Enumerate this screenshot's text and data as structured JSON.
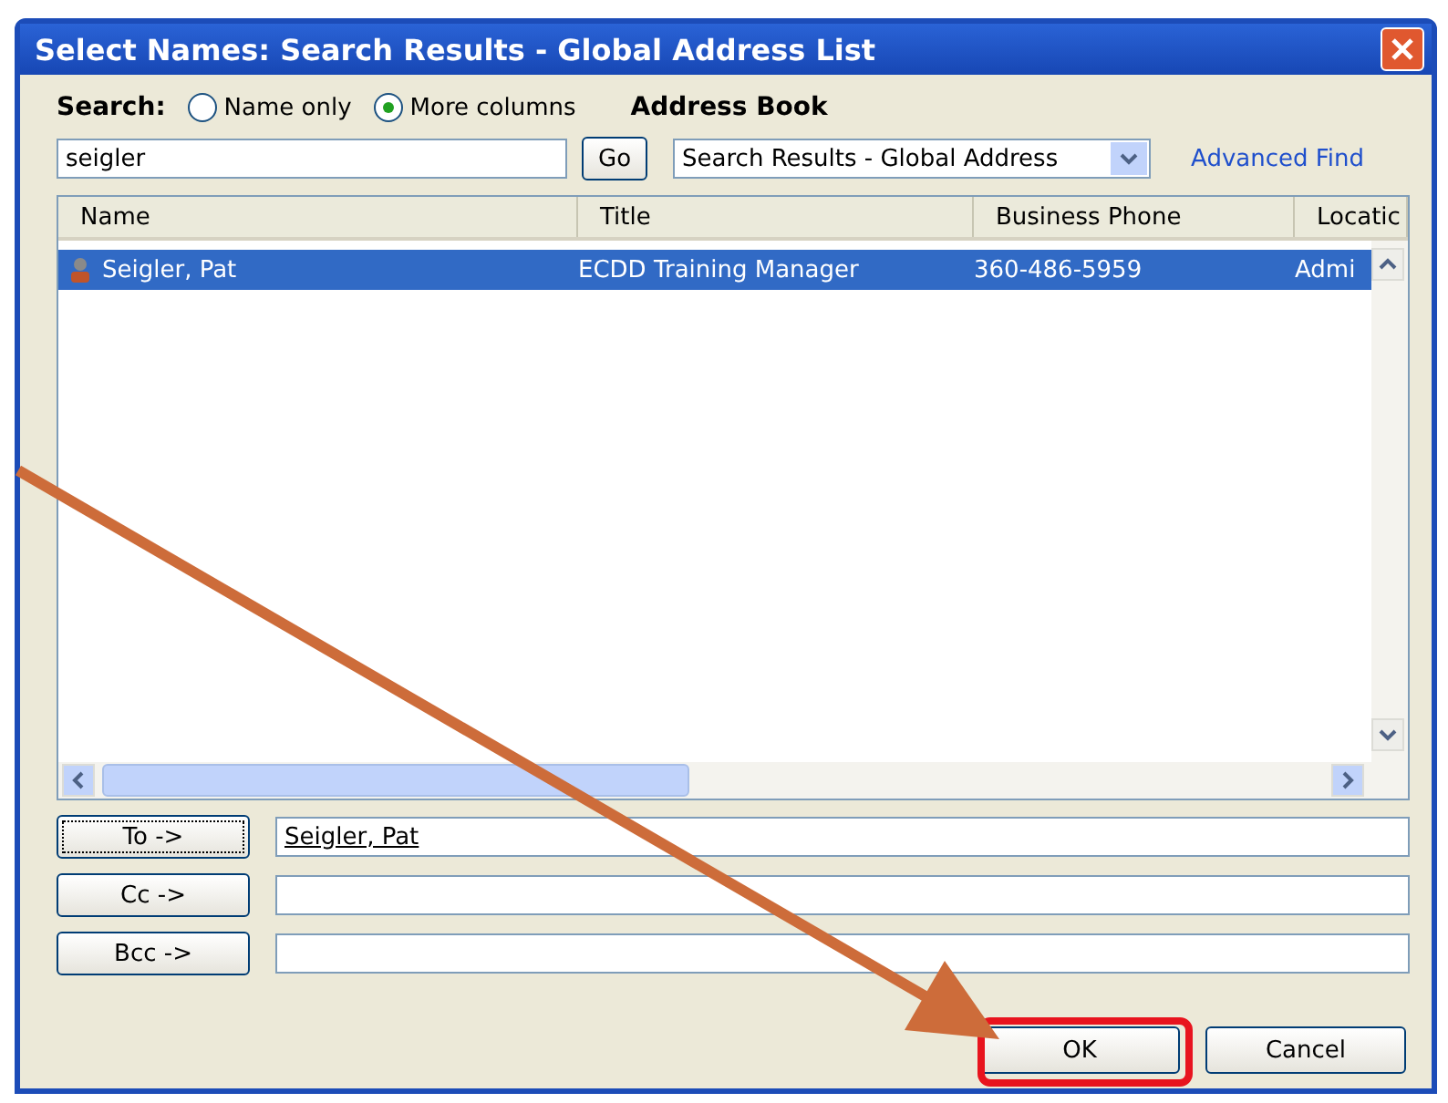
{
  "window": {
    "title": "Select Names: Search Results - Global Address List"
  },
  "search": {
    "label": "Search:",
    "value": "seigler",
    "go": "Go",
    "options": [
      {
        "label": "Name only",
        "selected": false
      },
      {
        "label": "More columns",
        "selected": true
      }
    ]
  },
  "address_book": {
    "label": "Address Book",
    "value": "Search Results - Global Address",
    "advanced_find": "Advanced Find"
  },
  "table": {
    "columns": [
      "Name",
      "Title",
      "Business Phone",
      "Locatic"
    ],
    "rows": [
      {
        "cells": [
          "Seigler, Pat",
          "ECDD Training Manager",
          "360-486-5959",
          "Admi"
        ],
        "selected": true
      }
    ]
  },
  "recipients": [
    {
      "button": "To ->",
      "value": "Seigler, Pat",
      "focused": true
    },
    {
      "button": "Cc ->",
      "focused": false
    },
    {
      "button": "Bcc ->",
      "focused": false
    }
  ],
  "buttons": [
    {
      "label": "OK",
      "highlighted": true
    },
    {
      "label": "Cancel",
      "highlighted": false
    }
  ],
  "annotation": {
    "arrow": true
  }
}
